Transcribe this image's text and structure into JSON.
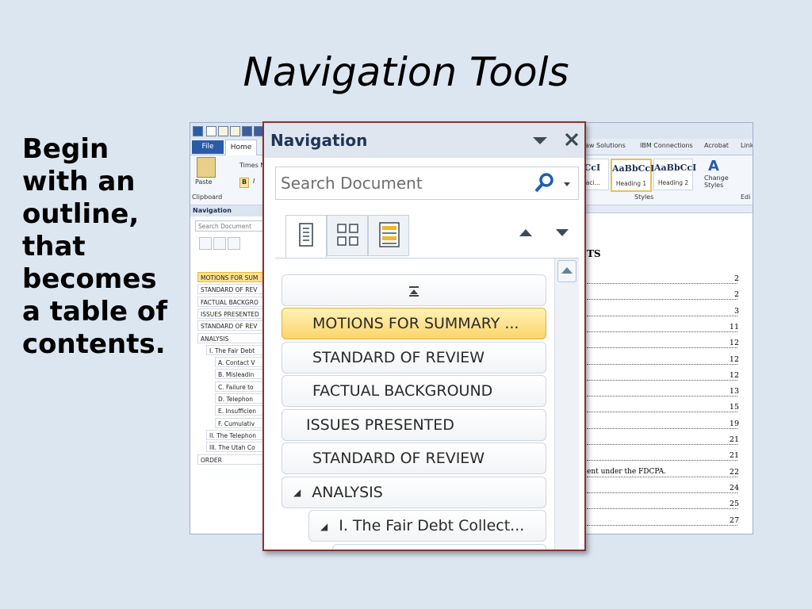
{
  "slide": {
    "title": "Navigation Tools",
    "bullet": "Begin with an outline, that becomes a table of contents."
  },
  "word": {
    "tabs": {
      "file": "File",
      "home": "Home",
      "others": [
        "aw Solutions",
        "IBM Connections",
        "Acrobat",
        "Link"
      ]
    },
    "ribbon": {
      "paste": "Paste",
      "clipboard": "Clipboard",
      "font_name": "Times N",
      "bold": "B",
      "italic": "I",
      "styles_label": "Styles",
      "change_styles": "Change Styles",
      "edit_partial": "Edi",
      "style_boxes": [
        {
          "preview": "bCcI",
          "name": "Spaci..."
        },
        {
          "preview": "AaBbCcI",
          "name": "Heading 1"
        },
        {
          "preview": "AaBbCcI",
          "name": "Heading 2"
        }
      ]
    },
    "small_nav": {
      "header": "Navigation",
      "search_placeholder": "Search Document",
      "items": [
        "MOTIONS FOR SUM",
        "STANDARD OF REV",
        "FACTUAL BACKGRO",
        "ISSUES PRESENTED",
        "STANDARD OF REV",
        "ANALYSIS",
        "I. The Fair Debt",
        "A. Contact V",
        "B. Misleadin",
        "C. Failure to",
        "D. Telephon",
        "E. Insufficien",
        "F. Cumulativ",
        "II. The Telephon",
        "III. The Utah Co",
        "ORDER"
      ]
    },
    "toc": {
      "heading": "TS",
      "pages": [
        "2",
        "2",
        "3",
        "11",
        "12",
        "12",
        "12",
        "13",
        "15",
        "19",
        "21",
        "21",
        "22",
        "24",
        "25",
        "27"
      ],
      "partial_text": "ent under the FDCPA."
    }
  },
  "nav_pane": {
    "title": "Navigation",
    "search_placeholder": "Search Document",
    "items": [
      {
        "label": "MOTIONS FOR SUMMARY ...",
        "highlighted": true,
        "level": 0,
        "arrow": false
      },
      {
        "label": "STANDARD OF REVIEW",
        "highlighted": false,
        "level": 0,
        "arrow": false
      },
      {
        "label": "FACTUAL BACKGROUND",
        "highlighted": false,
        "level": 0,
        "arrow": false
      },
      {
        "label": "ISSUES PRESENTED",
        "highlighted": false,
        "level": 0,
        "arrow": false
      },
      {
        "label": "STANDARD OF REVIEW",
        "highlighted": false,
        "level": 0,
        "arrow": false
      },
      {
        "label": "ANALYSIS",
        "highlighted": false,
        "level": 0,
        "arrow": true
      },
      {
        "label": "I. The Fair Debt Collect...",
        "highlighted": false,
        "level": 1,
        "arrow": true
      }
    ],
    "highlight_color": "#fbd56a"
  }
}
